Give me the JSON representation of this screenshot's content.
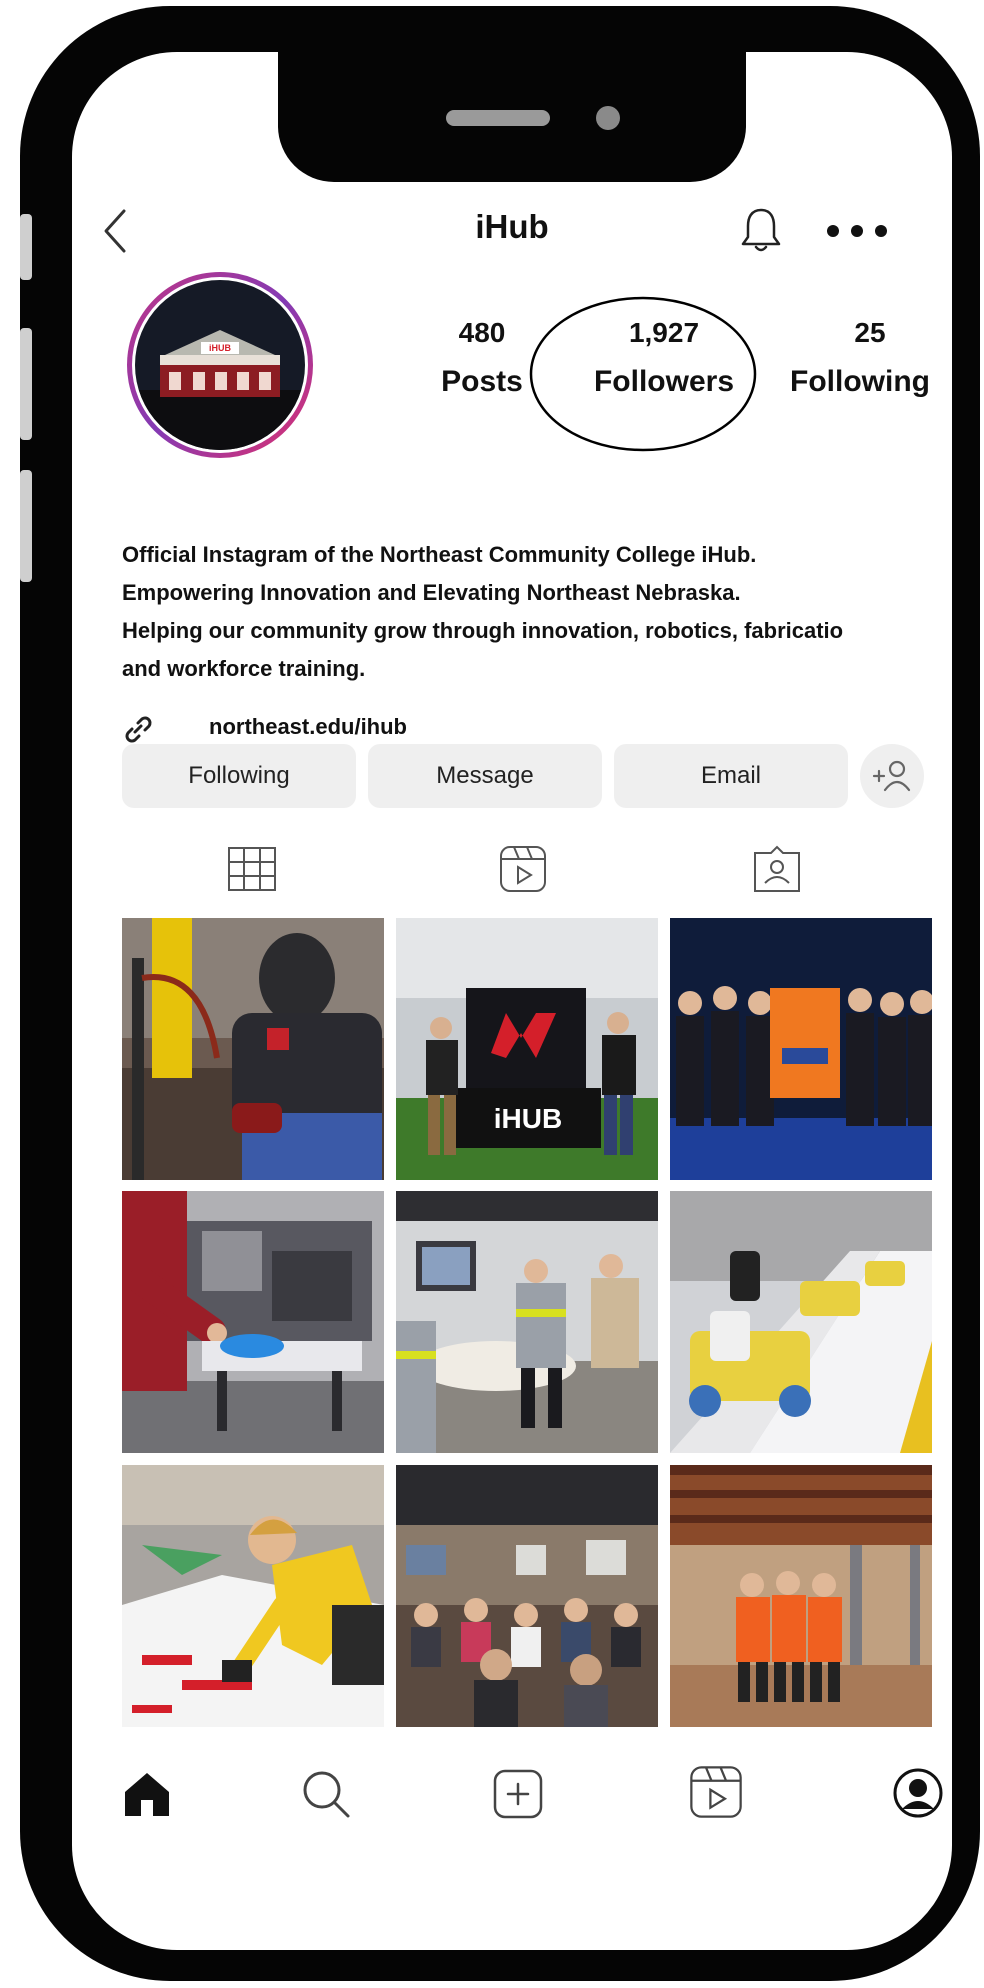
{
  "profile": {
    "username": "iHub",
    "stats": [
      {
        "count": "480",
        "label": "Posts"
      },
      {
        "count": "1,927",
        "label": "Followers"
      },
      {
        "count": "25",
        "label": "Following"
      }
    ],
    "bio_lines": [
      "Official Instagram of the Northeast Community College iHub.",
      "Empowering Innovation and Elevating Northeast Nebraska.",
      "Helping our community grow through innovation, robotics, fabricatio",
      "and workforce training."
    ],
    "link": "northeast.edu/ihub",
    "avatar_text": "iHUB"
  },
  "actions": {
    "following": "Following",
    "message": "Message",
    "email": "Email"
  },
  "posts": [
    {
      "alt": "welding"
    },
    {
      "alt": "iHub booth",
      "logo_text": "iHUB"
    },
    {
      "alt": "robotics team"
    },
    {
      "alt": "robotics lab"
    },
    {
      "alt": "workshop"
    },
    {
      "alt": "robot cars"
    },
    {
      "alt": "kid with robot"
    },
    {
      "alt": "seminar"
    },
    {
      "alt": "facility tour"
    }
  ],
  "icons": {
    "back": "chevron-left-icon",
    "bell": "bell-icon",
    "more": "more-icon",
    "link": "link-icon",
    "add_person": "add-person-icon",
    "grid": "grid-icon",
    "reels": "reels-icon",
    "tagged": "tagged-icon",
    "home": "home-icon",
    "search": "search-icon",
    "create": "create-icon",
    "profile": "profile-icon"
  },
  "colors": {
    "accent_red": "#d41f2a",
    "button_bg": "#efefef",
    "avatar_ring": "#c13584"
  }
}
